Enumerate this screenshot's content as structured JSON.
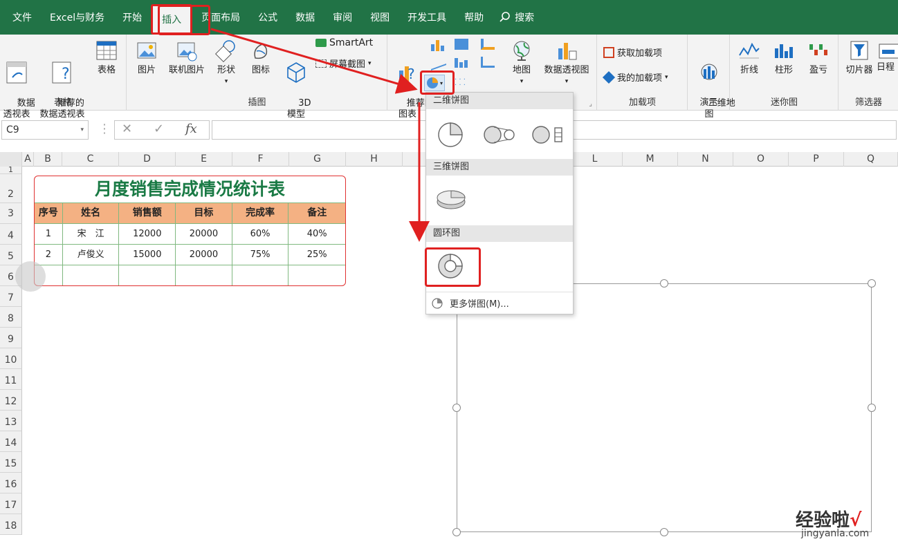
{
  "menubar": {
    "tabs": [
      "文件",
      "Excel与财务",
      "开始",
      "插入",
      "页面布局",
      "公式",
      "数据",
      "审阅",
      "视图",
      "开发工具",
      "帮助"
    ],
    "active_tab": "插入",
    "search_label": "搜索"
  },
  "ribbon": {
    "tables": {
      "label": "表格",
      "pivot": "数据\n透视表",
      "recommended_pivot": "推荐的\n数据透视表",
      "table": "表格"
    },
    "illustrations": {
      "label": "插图",
      "pictures": "图片",
      "online_pictures": "联机图片",
      "shapes": "形状",
      "icons": "图标",
      "models": "3D\n模型",
      "smartart": "SmartArt",
      "screenshot": "屏幕截图"
    },
    "charts": {
      "recommended": "推荐的\n图表",
      "maps": "地图",
      "pivot_chart": "数据透视图"
    },
    "addins": {
      "label": "加载项",
      "get": "获取加载项",
      "mine": "我的加载项"
    },
    "tours": {
      "label": "演示",
      "map3d": "三维地\n图"
    },
    "sparklines": {
      "label": "迷你图",
      "line": "折线",
      "column": "柱形",
      "winloss": "盈亏"
    },
    "filters": {
      "label": "筛选器",
      "slicer": "切片器",
      "timeline": "日程"
    }
  },
  "formula_bar": {
    "namebox": "C9",
    "fx": "fx",
    "cancel": "✕",
    "enter": "✓",
    "value": ""
  },
  "columns": [
    "A",
    "B",
    "C",
    "D",
    "E",
    "F",
    "G",
    "H",
    "L",
    "M",
    "N",
    "O",
    "P",
    "Q"
  ],
  "rows": [
    "1",
    "2",
    "3",
    "4",
    "5",
    "6",
    "7",
    "8",
    "9",
    "10",
    "11",
    "12",
    "13",
    "14",
    "15",
    "16",
    "17",
    "18"
  ],
  "table": {
    "title": "月度销售完成情况统计表",
    "headers": [
      "序号",
      "姓名",
      "销售额",
      "目标",
      "完成率",
      "备注"
    ],
    "rows": [
      [
        "1",
        "宋　江",
        "12000",
        "20000",
        "60%",
        "40%"
      ],
      [
        "2",
        "卢俊义",
        "15000",
        "20000",
        "75%",
        "25%"
      ],
      [
        "",
        "",
        "",
        "",
        "",
        ""
      ]
    ]
  },
  "dropdown": {
    "section_2d": "二维饼图",
    "section_3d": "三维饼图",
    "section_donut": "圆环图",
    "more": "更多饼图(M)..."
  },
  "watermark": {
    "main": "经验啦",
    "check": "√",
    "url": "jingyanla.com"
  },
  "colors": {
    "excel_green": "#217346",
    "highlight_red": "#e02020",
    "header_orange": "#f4b183",
    "title_green": "#1a7a45"
  }
}
